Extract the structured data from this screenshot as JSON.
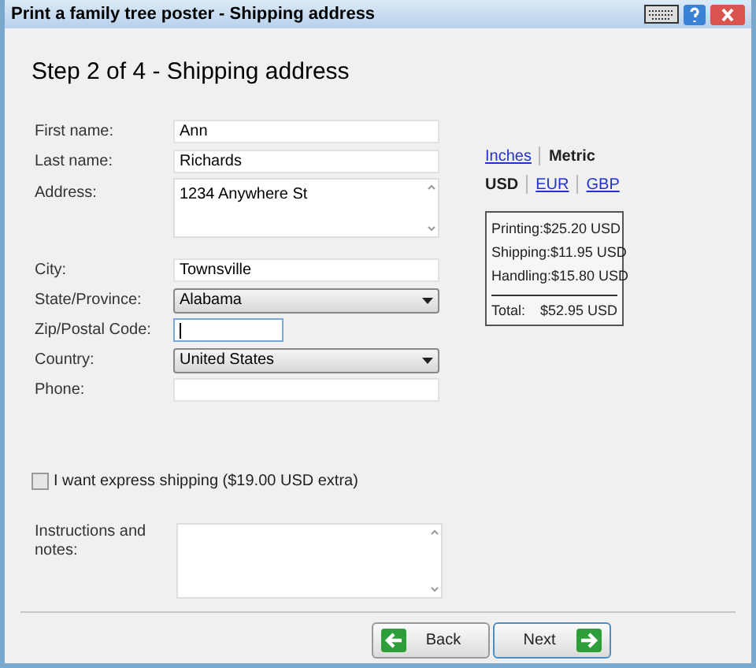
{
  "window": {
    "title": "Print a family tree poster - Shipping address"
  },
  "heading": "Step 2 of 4 - Shipping address",
  "fields": [
    {
      "label": "First name:",
      "kind": "text",
      "value": "Ann",
      "focused": false
    },
    {
      "label": "Last name:",
      "kind": "text",
      "value": "Richards",
      "focused": false
    },
    {
      "label": "Address:",
      "kind": "textarea",
      "value": "1234 Anywhere St",
      "focused": false
    },
    {
      "label": "City:",
      "kind": "text",
      "value": "Townsville",
      "focused": false
    },
    {
      "label": "State/Province:",
      "kind": "select",
      "value": "Alabama",
      "focused": false
    },
    {
      "label": "Zip/Postal Code:",
      "kind": "short",
      "focused": true
    },
    {
      "label": "Country:",
      "kind": "select",
      "value": "United States",
      "focused": false
    },
    {
      "label": "Phone:",
      "kind": "text",
      "focused": false
    }
  ],
  "units": [
    {
      "label": "Inches",
      "selected": false
    },
    {
      "label": "Metric",
      "selected": true
    }
  ],
  "currencies": [
    {
      "label": "USD",
      "selected": true
    },
    {
      "label": "EUR",
      "selected": false
    },
    {
      "label": "GBP",
      "selected": false
    }
  ],
  "costs": [
    {
      "label": "Printing:",
      "amount": "$25.20 USD"
    },
    {
      "label": "Shipping:",
      "amount": "$11.95 USD"
    },
    {
      "label": "Handling:",
      "amount": "$15.80 USD"
    }
  ],
  "total": {
    "label": "Total:",
    "amount": "$52.95 USD"
  },
  "express": {
    "label": "I want express shipping ($19.00 USD extra)",
    "checked": false
  },
  "notes": {
    "label": "Instructions and notes:"
  },
  "buttons": [
    {
      "label": "Back",
      "kind": "back",
      "focused": false
    },
    {
      "label": "Next",
      "kind": "next",
      "focused": true
    }
  ]
}
